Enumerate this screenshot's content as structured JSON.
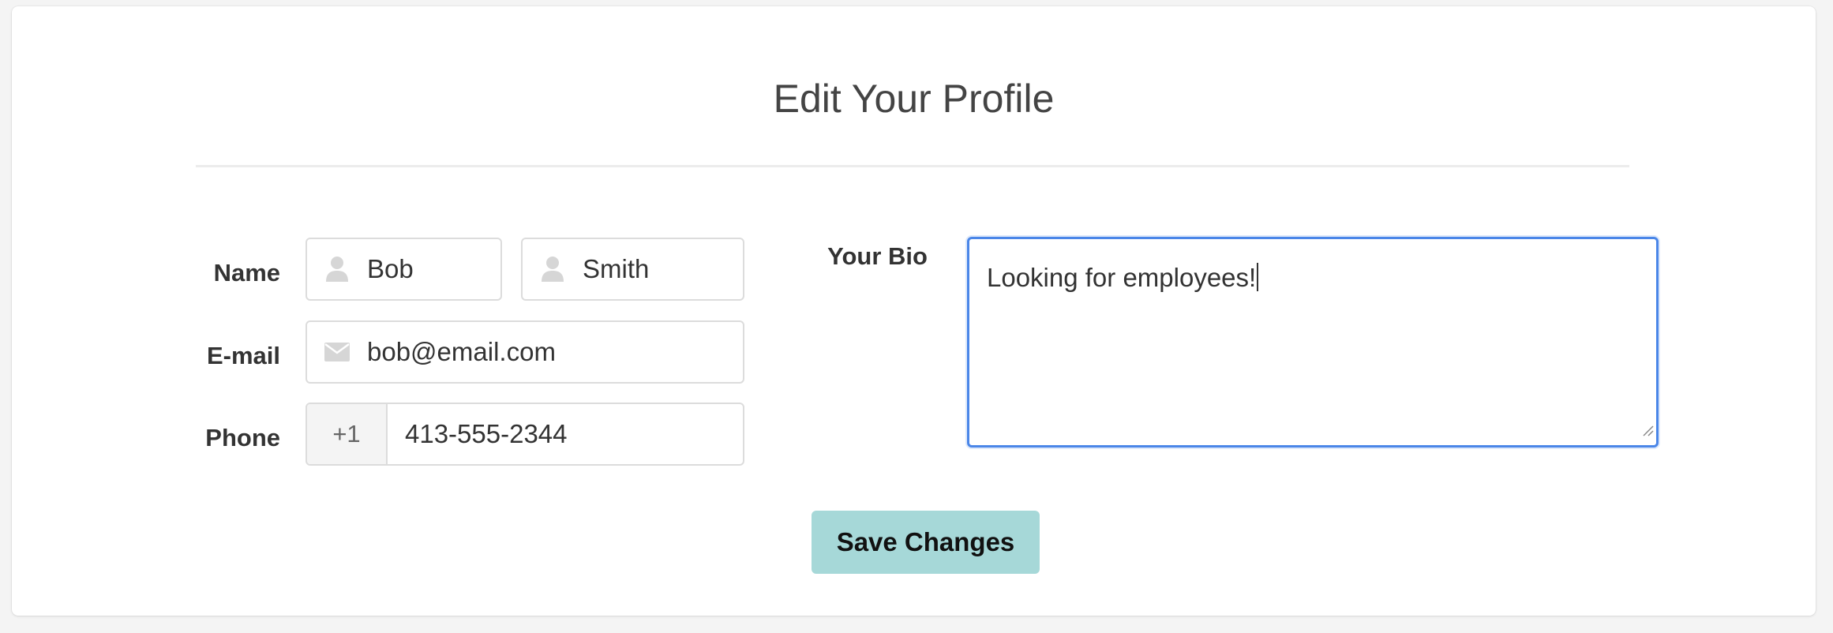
{
  "page": {
    "title": "Edit Your Profile",
    "save_label": "Save Changes"
  },
  "form": {
    "name_label": "Name",
    "first_name": "Bob",
    "last_name": "Smith",
    "email_label": "E-mail",
    "email": "bob@email.com",
    "phone_label": "Phone",
    "phone_prefix": "+1",
    "phone": "413-555-2344",
    "bio_label": "Your Bio",
    "bio": "Looking for employees!"
  },
  "icons": {
    "first_name": "user-icon",
    "last_name": "user-icon",
    "email": "envelope-icon"
  },
  "colors": {
    "accent": "#4a86e8",
    "button": "#a6d8d8"
  }
}
